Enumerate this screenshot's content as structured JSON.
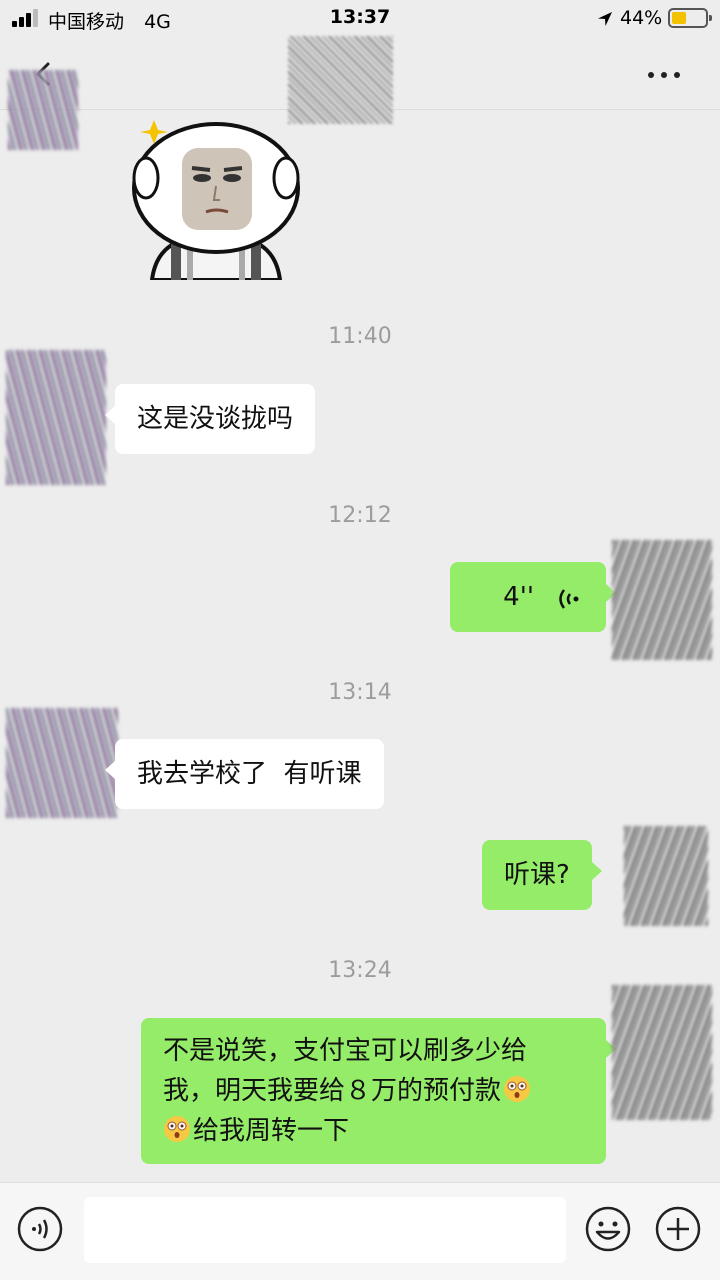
{
  "status_bar": {
    "carrier": "中国移动",
    "network": "4G",
    "time": "13:37",
    "battery_percent": "44%",
    "battery_level": 0.44,
    "battery_color": "#f2c200"
  },
  "nav": {
    "back_icon": "chevron-left-icon",
    "more_icon": "ellipsis-icon"
  },
  "colors": {
    "background": "#ededed",
    "incoming_bubble": "#ffffff",
    "outgoing_bubble": "#95ec69",
    "timestamp_text": "#9c9c9c"
  },
  "messages": [
    {
      "type": "sticker",
      "direction": "in",
      "description_icon": "bald-man-sticker-icon"
    },
    {
      "type": "timestamp",
      "text": "11:40"
    },
    {
      "type": "text",
      "direction": "in",
      "text": "这是没谈拢吗"
    },
    {
      "type": "timestamp",
      "text": "12:12"
    },
    {
      "type": "voice",
      "direction": "out",
      "duration": "4''",
      "icon": "voice-wave-icon"
    },
    {
      "type": "timestamp",
      "text": "13:14"
    },
    {
      "type": "text",
      "direction": "in",
      "text": "我去学校了  有听课"
    },
    {
      "type": "text",
      "direction": "out",
      "text": "听课?"
    },
    {
      "type": "timestamp",
      "text": "13:24"
    },
    {
      "type": "text",
      "direction": "out",
      "line1": "不是说笑，支付宝可以刷多少给",
      "line2": "我，明天我要给８万的预付款",
      "line3": "给我周转一下",
      "emoji": "astonished-face-icon"
    }
  ],
  "input_bar": {
    "voice_icon": "voice-mode-icon",
    "emoji_icon": "smiley-icon",
    "plus_icon": "plus-icon",
    "text_value": ""
  }
}
